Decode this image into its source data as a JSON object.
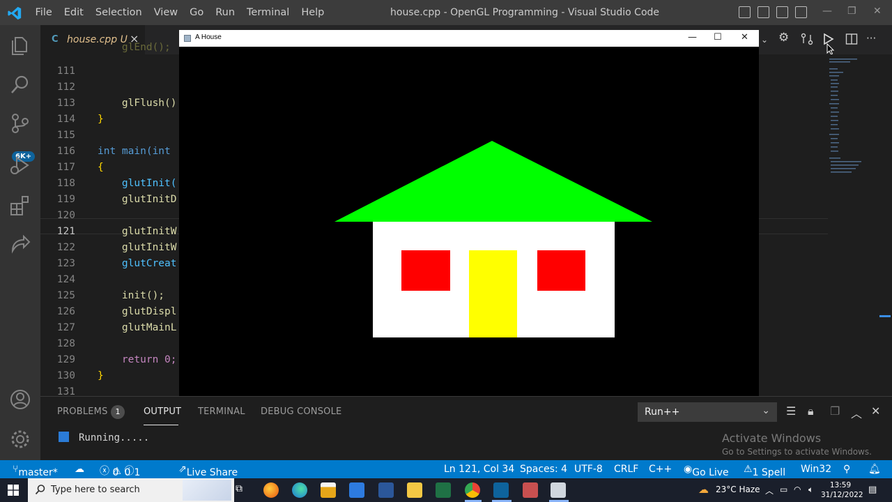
{
  "titlebar": {
    "menu": [
      "File",
      "Edit",
      "Selection",
      "View",
      "Go",
      "Run",
      "Terminal",
      "Help"
    ],
    "title": "house.cpp - OpenGL Programming - Visual Studio Code"
  },
  "activitybar": {
    "source_control_badge": "6K+"
  },
  "tab": {
    "icon": "C",
    "filename": "house.cpp",
    "status": "U",
    "close": "×"
  },
  "editor": {
    "lines": [
      {
        "no": "",
        "code": "    glEnd();"
      },
      {
        "no": "111",
        "code": ""
      },
      {
        "no": "112",
        "code": ""
      },
      {
        "no": "113",
        "code": "    glFlush()"
      },
      {
        "no": "114",
        "code": "}"
      },
      {
        "no": "115",
        "code": ""
      },
      {
        "no": "116",
        "code": "int main(int"
      },
      {
        "no": "117",
        "code": "{"
      },
      {
        "no": "118",
        "code": "    glutInit("
      },
      {
        "no": "119",
        "code": "    glutInitD"
      },
      {
        "no": "120",
        "code": ""
      },
      {
        "no": "121",
        "code": "    glutInitW"
      },
      {
        "no": "122",
        "code": "    glutInitW"
      },
      {
        "no": "123",
        "code": "    glutCreat"
      },
      {
        "no": "124",
        "code": ""
      },
      {
        "no": "125",
        "code": "    init();"
      },
      {
        "no": "126",
        "code": "    glutDispl"
      },
      {
        "no": "127",
        "code": "    glutMainL"
      },
      {
        "no": "128",
        "code": ""
      },
      {
        "no": "129",
        "code": "    return 0;"
      },
      {
        "no": "130",
        "code": "}"
      },
      {
        "no": "131",
        "code": ""
      }
    ]
  },
  "gl_window": {
    "title": "A House",
    "colors": {
      "background": "#000000",
      "roof": "#00ff00",
      "walls": "#ffffff",
      "windows": "#ff0000",
      "door": "#ffff00"
    }
  },
  "panel": {
    "tabs": [
      "PROBLEMS",
      "OUTPUT",
      "TERMINAL",
      "DEBUG CONSOLE"
    ],
    "problems_count": "1",
    "active_tab": "OUTPUT",
    "channel": "Run++",
    "output_text": "Running.....",
    "watermark_title": "Activate Windows",
    "watermark_sub": "Go to Settings to activate Windows."
  },
  "statusbar": {
    "branch": "master*",
    "errors": "0",
    "warnings": "0",
    "info": "1",
    "live_share": "Live Share",
    "position": "Ln 121, Col 34",
    "spaces": "Spaces: 4",
    "encoding": "UTF-8",
    "eol": "CRLF",
    "language": "C++",
    "go_live": "Go Live",
    "spell": "1 Spell",
    "platform": "Win32"
  },
  "taskbar": {
    "search_placeholder": "Type here to search",
    "weather": "23°C  Haze",
    "time": "13:59",
    "date": "31/12/2022"
  }
}
